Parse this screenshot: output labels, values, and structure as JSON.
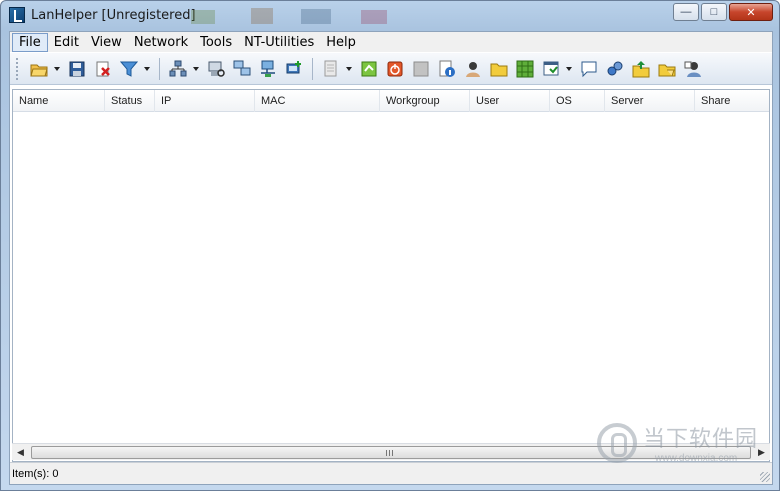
{
  "window": {
    "title": "LanHelper [Unregistered]",
    "controls": {
      "minimize": "—",
      "maximize": "□",
      "close": "✕"
    }
  },
  "menu": [
    {
      "label": "File",
      "active": true
    },
    {
      "label": "Edit"
    },
    {
      "label": "View"
    },
    {
      "label": "Network"
    },
    {
      "label": "Tools"
    },
    {
      "label": "NT-Utilities"
    },
    {
      "label": "Help"
    }
  ],
  "toolbar": {
    "buttons": [
      "open-folder-icon",
      "save-icon",
      "delete-icon",
      "filter-icon",
      "scan-network-icon",
      "computer-scan-icon",
      "computers-icon",
      "network-share-icon",
      "add-computer-icon",
      "document-icon",
      "refresh-green-icon",
      "power-icon",
      "blank-gray-icon",
      "info-icon",
      "user-icon",
      "folder-icon",
      "grid-icon",
      "window-list-icon",
      "message-icon",
      "services-icon",
      "share-up-icon",
      "open-share-icon",
      "user-manage-icon"
    ]
  },
  "list": {
    "columns": [
      "Name",
      "Status",
      "IP",
      "MAC",
      "Workgroup",
      "User",
      "OS",
      "Server",
      "Share"
    ],
    "rows": []
  },
  "statusbar": {
    "items_text": "Item(s): 0"
  },
  "watermark": {
    "cn": "当下软件园",
    "url": "www.downxia.com"
  },
  "colors": {
    "accent": "#3a6ea5",
    "close": "#c7452c"
  }
}
